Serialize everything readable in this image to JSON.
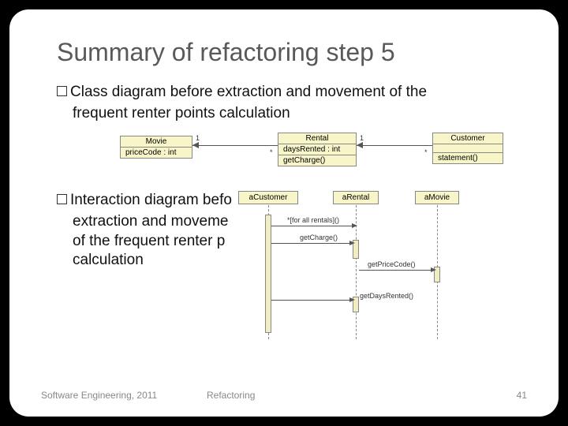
{
  "title": "Summary of refactoring step 5",
  "bullet1": {
    "lead": "Class",
    "rest": " diagram before extraction and movement of the"
  },
  "bullet1_line2": "frequent renter points calculation",
  "classDiagram": {
    "movie": {
      "name": "Movie",
      "attr": "priceCode : int"
    },
    "rental": {
      "name": "Rental",
      "attr1": "daysRented : int",
      "attr2": "getCharge()"
    },
    "customer": {
      "name": "Customer",
      "attr": "statement()"
    },
    "mult": {
      "m1l": "1",
      "m1r": "*",
      "m2l": "1",
      "m2r": "*"
    }
  },
  "bullet2": {
    "lead": "Interaction",
    "rest": " diagram befo"
  },
  "bullet2_lines": {
    "l2": "extraction and moveme",
    "l3": " of the frequent renter p",
    "l4": " calculation"
  },
  "seq": {
    "obj1": "aCustomer",
    "obj2": "aRental",
    "obj3": "aMovie",
    "msg1": "*[for all rentals]()",
    "msg2": "getCharge()",
    "msg3": "getPriceCode()",
    "msg4": "getDaysRented()"
  },
  "footer": {
    "left": "Software Engineering, 2011",
    "center": "Refactoring",
    "page": "41"
  }
}
